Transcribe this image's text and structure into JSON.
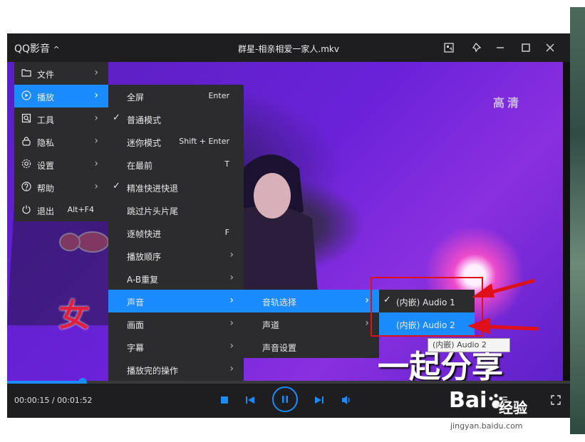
{
  "app": {
    "brand": "QQ影音",
    "brand_chevron": "^",
    "window_title": "群星-相亲相爱一家人.mkv"
  },
  "video": {
    "hd_badge": "高清",
    "lyric_left": "女",
    "lyric_bottom": "一起分享"
  },
  "playback": {
    "current_time": "00:00:15",
    "total_time": "00:01:52",
    "progress_fraction": 0.134
  },
  "main_menu": {
    "items": [
      {
        "label": "文件",
        "icon": "folder-icon",
        "shortcut": "",
        "has_submenu": true
      },
      {
        "label": "播放",
        "icon": "play-circle-icon",
        "shortcut": "",
        "has_submenu": true,
        "highlighted": true
      },
      {
        "label": "工具",
        "icon": "tools-icon",
        "shortcut": "",
        "has_submenu": true
      },
      {
        "label": "隐私",
        "icon": "lock-icon",
        "shortcut": "",
        "has_submenu": true
      },
      {
        "label": "设置",
        "icon": "gear-icon",
        "shortcut": "",
        "has_submenu": true
      },
      {
        "label": "帮助",
        "icon": "help-icon",
        "shortcut": "",
        "has_submenu": true
      },
      {
        "label": "退出",
        "icon": "power-icon",
        "shortcut": "Alt+F4",
        "has_submenu": false
      }
    ]
  },
  "play_menu": {
    "items": [
      {
        "label": "全屏",
        "shortcut": "Enter",
        "checked": false,
        "has_submenu": false
      },
      {
        "label": "普通模式",
        "shortcut": "",
        "checked": true,
        "has_submenu": false
      },
      {
        "label": "迷你模式",
        "shortcut": "Shift + Enter",
        "checked": false,
        "has_submenu": false
      },
      {
        "label": "在最前",
        "shortcut": "T",
        "checked": false,
        "has_submenu": false
      },
      {
        "label": "精准快进快退",
        "shortcut": "",
        "checked": true,
        "has_submenu": false
      },
      {
        "label": "跳过片头片尾",
        "shortcut": "",
        "checked": false,
        "has_submenu": false
      },
      {
        "label": "逐帧快进",
        "shortcut": "F",
        "checked": false,
        "has_submenu": false
      },
      {
        "label": "播放顺序",
        "shortcut": "",
        "checked": false,
        "has_submenu": true
      },
      {
        "label": "A-B重复",
        "shortcut": "",
        "checked": false,
        "has_submenu": true
      },
      {
        "label": "声音",
        "shortcut": "",
        "checked": false,
        "has_submenu": true,
        "highlighted": true
      },
      {
        "label": "画面",
        "shortcut": "",
        "checked": false,
        "has_submenu": true
      },
      {
        "label": "字幕",
        "shortcut": "",
        "checked": false,
        "has_submenu": true
      },
      {
        "label": "播放完的操作",
        "shortcut": "",
        "checked": false,
        "has_submenu": true
      }
    ]
  },
  "sound_menu": {
    "items": [
      {
        "label": "音轨选择",
        "has_submenu": true,
        "highlighted": true
      },
      {
        "label": "声道",
        "has_submenu": true
      },
      {
        "label": "声音设置",
        "has_submenu": false
      }
    ]
  },
  "track_menu": {
    "items": [
      {
        "label": "(内嵌) Audio 1",
        "checked": true
      },
      {
        "label": "(内嵌) Audio 2",
        "checked": false,
        "highlighted": true
      }
    ]
  },
  "tooltip": {
    "text": "(内嵌) Audio 2"
  },
  "watermark": {
    "logo": "Bai",
    "logo_suffix": "经验",
    "url": "jingyan.baidu.com"
  },
  "colors": {
    "accent": "#1a8cff",
    "menu_bg": "#2c2c2e",
    "annotation_red": "#e0101a"
  }
}
